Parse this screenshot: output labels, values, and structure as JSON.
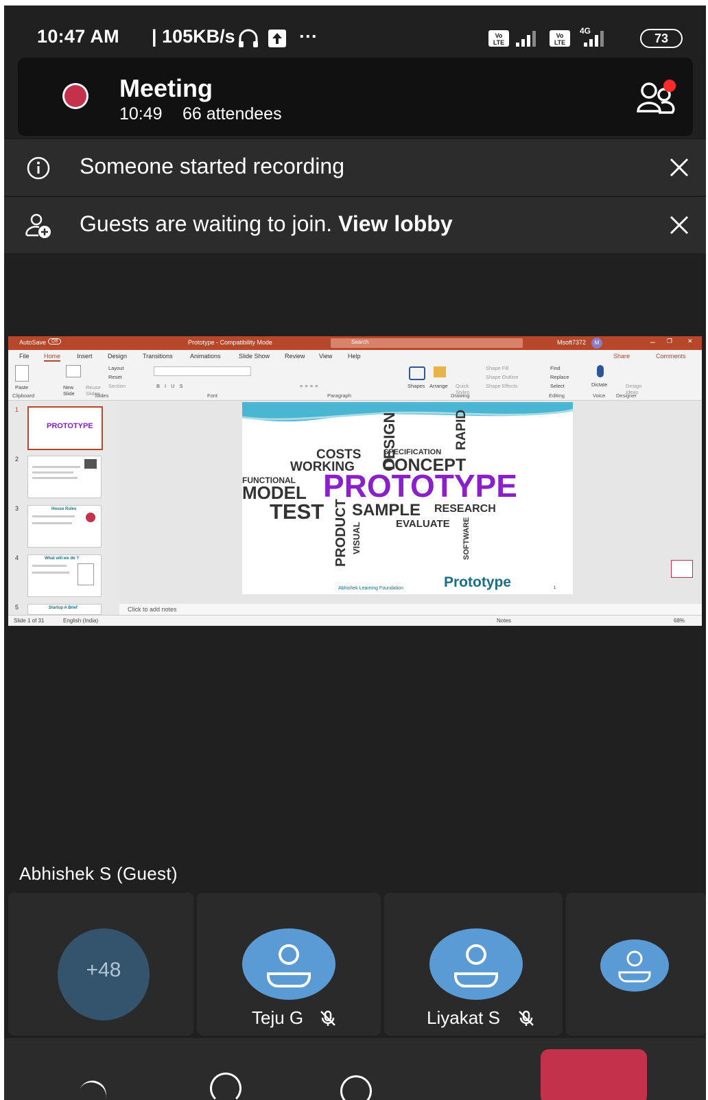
{
  "status_bar": {
    "time": "10:47 AM",
    "network_speed": "| 105KB/s",
    "more": "···",
    "network_4g": "4G",
    "battery": "73"
  },
  "meeting": {
    "title": "Meeting",
    "elapsed": "10:49",
    "attendees": "66 attendees"
  },
  "banners": {
    "recording": "Someone started recording",
    "lobby_text": "Guests are waiting to join.",
    "lobby_link": "View lobby"
  },
  "ppt": {
    "titlebar": {
      "autosave": "AutoSave",
      "autosave_state": "Off",
      "doc_title": "Prototype - Compatibility Mode",
      "search": "Search",
      "user": "Msoft7372"
    },
    "tabs": [
      "File",
      "Home",
      "Insert",
      "Design",
      "Transitions",
      "Animations",
      "Slide Show",
      "Review",
      "View",
      "Help"
    ],
    "share": "Share",
    "comments": "Comments",
    "ribbon_groups": [
      "Clipboard",
      "Slides",
      "Font",
      "Paragraph",
      "Drawing",
      "Editing",
      "Voice",
      "Designer"
    ],
    "ribbon_items": {
      "paste": "Paste",
      "new_slide": "New Slide",
      "reuse_slides": "Reuse Slides",
      "layout": "Layout",
      "reset": "Reset",
      "section": "Section",
      "shapes": "Shapes",
      "arrange": "Arrange",
      "quick_styles": "Quick Styles",
      "shape_fill": "Shape Fill",
      "shape_outline": "Shape Outline",
      "shape_effects": "Shape Effects",
      "find": "Find",
      "replace": "Replace",
      "select": "Select",
      "dictate": "Dictate",
      "design_ideas": "Design Ideas"
    },
    "notes_placeholder": "Click to add notes",
    "status": {
      "slide": "Slide 1 of 31",
      "language": "English (India)",
      "notes": "Notes",
      "zoom": "68%"
    },
    "thumbnails": [
      {
        "num": "1",
        "title": "PROTOTYPE"
      },
      {
        "num": "2",
        "title": ""
      },
      {
        "num": "3",
        "title": "House Rules"
      },
      {
        "num": "4",
        "title": "What will we do ?"
      },
      {
        "num": "5",
        "title": "Startup A Brief"
      }
    ],
    "slide": {
      "words": {
        "costs": "COSTS",
        "working": "WORKING",
        "design": "DESIGN",
        "specification": "SPECIFICATION",
        "rapid": "RAPID",
        "concept": "CONCEPT",
        "functional": "FUNCTIONAL",
        "model": "MODEL",
        "prototype": "PROTOTYPE",
        "test": "TEST",
        "product": "PRODUCT",
        "sample": "SAMPLE",
        "research": "RESEARCH",
        "visual": "VISUAL",
        "evaluate": "EVALUATE",
        "software": "SOFTWARE"
      },
      "footer": "Abhishek Learning Foundation",
      "title": "Prototype",
      "page": "1"
    }
  },
  "presenter": "Abhishek S (Guest)",
  "participants": [
    {
      "name": "",
      "overflow": "+48"
    },
    {
      "name": "Teju G"
    },
    {
      "name": "Liyakat S"
    },
    {
      "name": ""
    }
  ],
  "colors": {
    "background": "#202020",
    "recording": "#c4314b",
    "avatar": "#5b9bd5",
    "powerpoint": "#b7472a",
    "prototype_word": "#8b1fc9",
    "prototype_title": "#1a6f86"
  }
}
